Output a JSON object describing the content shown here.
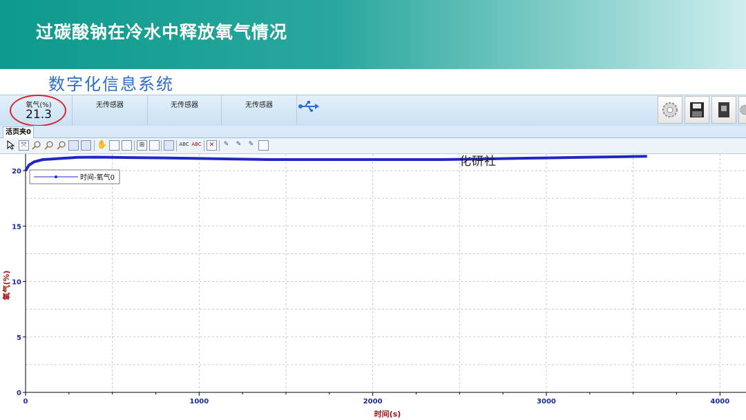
{
  "slide": {
    "title": "过碳酸钠在冷水中释放氧气情况"
  },
  "app": {
    "header": "数字化信息系统"
  },
  "sensors": [
    {
      "name": "氧气(%)",
      "value": "21.3",
      "highlighted": true
    },
    {
      "name": "无传感器",
      "value": ""
    },
    {
      "name": "无传感器",
      "value": ""
    },
    {
      "name": "无传感器",
      "value": ""
    }
  ],
  "toolbar_right": [
    "settings-gear-icon",
    "save-disk-icon",
    "book-icon",
    "gear-icon"
  ],
  "tab": {
    "label": "活页夹0"
  },
  "toolbar_tools": [
    "pointer",
    "zoom-fit",
    "zoom-in",
    "zoom-out",
    "zoom",
    "view-a",
    "view-b",
    "hand-pan",
    "ruler",
    "v-ruler",
    "grid",
    "table",
    "save",
    "text-abc",
    "text-abc-del",
    "delete",
    "pen-1",
    "pen-2",
    "pen-3",
    "image"
  ],
  "watermark": "化研社",
  "chart_data": {
    "type": "line",
    "title": "",
    "xlabel": "时间(s)",
    "ylabel": "氧气(%)",
    "xlim": [
      0,
      4150
    ],
    "ylim": [
      0,
      21.5
    ],
    "x_ticks": [
      0,
      1000,
      2000,
      3000,
      4000
    ],
    "y_ticks": [
      0,
      5,
      10,
      15,
      20
    ],
    "grid": true,
    "legend": {
      "placement": "top-left",
      "entries": [
        "时间-氧气0"
      ]
    },
    "series": [
      {
        "name": "时间-氧气0",
        "color": "#1f28c6",
        "x": [
          0,
          20,
          50,
          100,
          150,
          200,
          250,
          300,
          400,
          500,
          600,
          800,
          1000,
          1200,
          1400,
          1600,
          1800,
          2000,
          2200,
          2400,
          2600,
          2800,
          3000,
          3200,
          3400,
          3580
        ],
        "y": [
          20.0,
          20.5,
          20.8,
          21.0,
          21.05,
          21.1,
          21.15,
          21.2,
          21.22,
          21.2,
          21.18,
          21.15,
          21.1,
          21.05,
          21.0,
          21.0,
          21.0,
          21.0,
          21.0,
          21.0,
          21.05,
          21.1,
          21.15,
          21.2,
          21.25,
          21.3
        ]
      }
    ],
    "colors": {
      "axis_label": "#a01010",
      "tick_label": "#1c2b9c",
      "grid": "#c8c8c8"
    }
  }
}
